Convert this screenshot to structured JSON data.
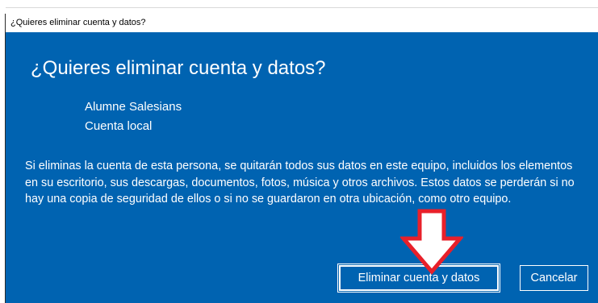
{
  "window": {
    "title": "¿Quieres eliminar cuenta y datos?"
  },
  "dialog": {
    "heading": "¿Quieres eliminar cuenta y datos?",
    "account_name": "Alumne Salesians",
    "account_type": "Cuenta local",
    "message": "Si eliminas la cuenta de esta persona, se quitarán todos sus datos en este equipo, incluidos los elementos en su escritorio, sus descargas, documentos, fotos, música y otros archivos. Estos datos se perderán si no hay una copia de seguridad de ellos o si no se guardaron en otra ubicación, como otro equipo.",
    "buttons": {
      "delete_label": "Eliminar cuenta y datos",
      "cancel_label": "Cancelar"
    }
  },
  "annotation": {
    "arrow_icon": "down-arrow-icon",
    "arrow_color": "#e8202a"
  },
  "colors": {
    "dialog_background": "#0063b1",
    "text": "#ffffff"
  }
}
